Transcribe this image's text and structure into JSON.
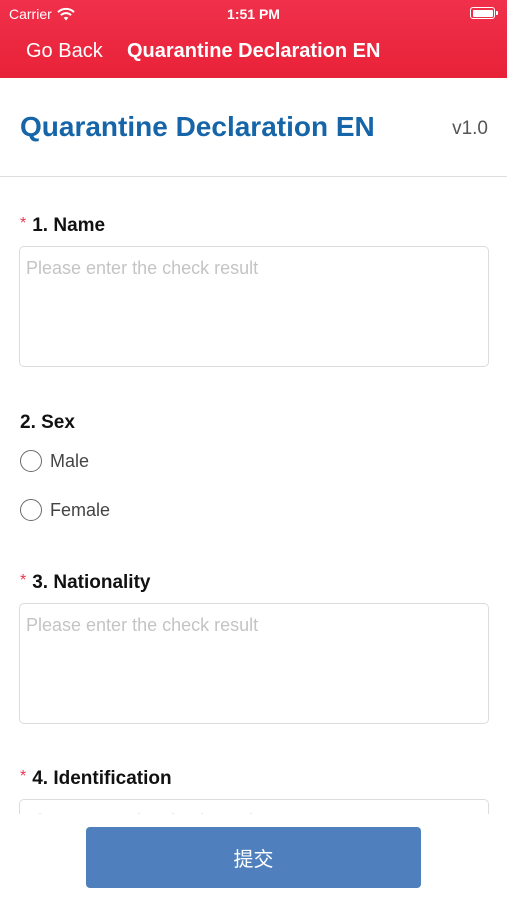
{
  "status_bar": {
    "carrier": "Carrier",
    "time": "1:51 PM",
    "icons": [
      "wifi-icon",
      "battery-icon"
    ]
  },
  "nav": {
    "back_label": "Go Back",
    "title": "Quarantine Declaration EN"
  },
  "form": {
    "title": "Quarantine Declaration EN",
    "version": "v1.0",
    "questions": [
      {
        "number_label": "1. Name",
        "required": true,
        "required_mark": "*",
        "placeholder": "Please enter the check result",
        "value": ""
      },
      {
        "number_label": "2. Sex",
        "required": false,
        "options": [
          "Male",
          "Female"
        ],
        "selected": null
      },
      {
        "number_label": "3. Nationality",
        "required": true,
        "required_mark": "*",
        "placeholder": "Please enter the check result",
        "value": ""
      },
      {
        "number_label": "4. Identification",
        "required": true,
        "required_mark": "*",
        "placeholder": "Please enter the check result",
        "value": ""
      }
    ]
  },
  "submit_label": "提交",
  "colors": {
    "header_bg": "#ee2a43",
    "title_blue": "#1565a8",
    "required_red": "#e8384f",
    "submit_bg": "#4f80bd"
  }
}
